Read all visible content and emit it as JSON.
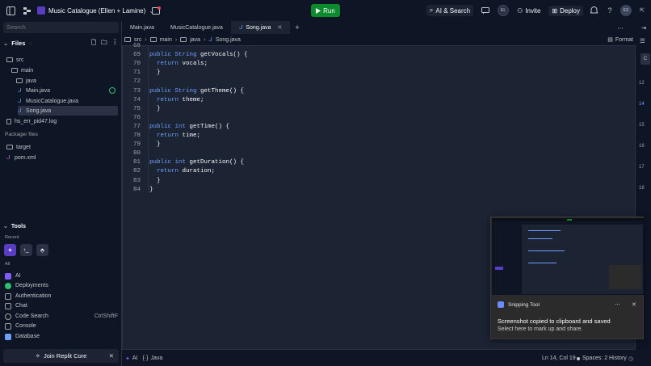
{
  "topbar": {
    "project_name": "Music Catalogue (Ellen + Lamine)",
    "run_label": "Run",
    "ai_search_label": "AI & Search",
    "avatar_initials": "EL",
    "invite_label": "Invite",
    "deploy_label": "Deploy",
    "user_initials": "ES"
  },
  "sidebar": {
    "search_placeholder": "Search",
    "files_label": "Files",
    "tree": [
      {
        "label": "src",
        "type": "folder"
      },
      {
        "label": "main",
        "type": "folder"
      },
      {
        "label": "java",
        "type": "folder"
      },
      {
        "label": "Main.java",
        "type": "java"
      },
      {
        "label": "MusicCatalogue.java",
        "type": "java"
      },
      {
        "label": "Song.java",
        "type": "java"
      },
      {
        "label": "hs_err_pid47.log",
        "type": "file"
      }
    ],
    "packager_label": "Packager files",
    "packager": [
      {
        "label": "target",
        "type": "folder"
      },
      {
        "label": "pom.xml",
        "type": "file"
      }
    ],
    "tools_label": "Tools",
    "recent_label": "Recent",
    "all_label": "All",
    "tools": [
      {
        "label": "AI",
        "color": "#7c5cff"
      },
      {
        "label": "Deployments",
        "color": "#2fbf71"
      },
      {
        "label": "Authentication",
        "color": "#9da2a6"
      },
      {
        "label": "Chat",
        "color": "#9da2a6"
      },
      {
        "label": "Code Search",
        "color": "#9da2a6",
        "shortcut": "CtrlShiftF"
      },
      {
        "label": "Console",
        "color": "#9da2a6"
      },
      {
        "label": "Database",
        "color": "#6ea0ff"
      }
    ],
    "core_label": "Join Replit Core"
  },
  "tabs": [
    {
      "label": "Main.java",
      "active": false
    },
    {
      "label": "MusicCatalogue.java",
      "active": false
    },
    {
      "label": "Song.java",
      "active": true
    }
  ],
  "breadcrumb": [
    "src",
    "main",
    "java",
    "Song.java"
  ],
  "format_label": "Format",
  "code": [
    {
      "n": "68",
      "text": ""
    },
    {
      "n": "69",
      "parts": [
        [
          "kw",
          "public String "
        ],
        [
          "fn",
          "getVocals"
        ],
        [
          "",
          "() {"
        ]
      ]
    },
    {
      "n": "70",
      "parts": [
        [
          "kw",
          "  return "
        ],
        [
          "var",
          "vocals"
        ],
        [
          "",
          ";"
        ]
      ]
    },
    {
      "n": "71",
      "parts": [
        [
          "",
          "  }"
        ]
      ]
    },
    {
      "n": "72",
      "parts": []
    },
    {
      "n": "73",
      "parts": [
        [
          "kw",
          "public String "
        ],
        [
          "fn",
          "getTheme"
        ],
        [
          "",
          "() {"
        ]
      ]
    },
    {
      "n": "74",
      "parts": [
        [
          "kw",
          "  return "
        ],
        [
          "var",
          "theme"
        ],
        [
          "",
          ";"
        ]
      ]
    },
    {
      "n": "75",
      "parts": [
        [
          "",
          "  }"
        ]
      ]
    },
    {
      "n": "76",
      "parts": []
    },
    {
      "n": "77",
      "parts": [
        [
          "kw",
          "public int "
        ],
        [
          "fn",
          "getTime"
        ],
        [
          "",
          "() {"
        ]
      ]
    },
    {
      "n": "78",
      "parts": [
        [
          "kw",
          "  return "
        ],
        [
          "var",
          "time"
        ],
        [
          "",
          ";"
        ]
      ]
    },
    {
      "n": "79",
      "parts": [
        [
          "",
          "  }"
        ]
      ]
    },
    {
      "n": "80",
      "parts": []
    },
    {
      "n": "81",
      "parts": [
        [
          "kw",
          "public int "
        ],
        [
          "fn",
          "getDuration"
        ],
        [
          "",
          "() {"
        ]
      ]
    },
    {
      "n": "82",
      "parts": [
        [
          "kw",
          "  return "
        ],
        [
          "var",
          "duration"
        ],
        [
          "",
          ";"
        ]
      ]
    },
    {
      "n": "83",
      "parts": [
        [
          "",
          "  }"
        ]
      ]
    },
    {
      "n": "84",
      "parts": [
        [
          "",
          "}"
        ]
      ]
    }
  ],
  "rail_numbers": [
    "12",
    "14",
    "15",
    "16",
    "17",
    "18"
  ],
  "status": {
    "ai": "AI",
    "lang": "Java",
    "position": "Ln 14, Col 19",
    "spaces": "Spaces: 2",
    "history": "History"
  },
  "snipping": {
    "app": "Snipping Tool",
    "message": "Screenshot copied to clipboard and saved",
    "sub": "Select here to mark up and share."
  }
}
